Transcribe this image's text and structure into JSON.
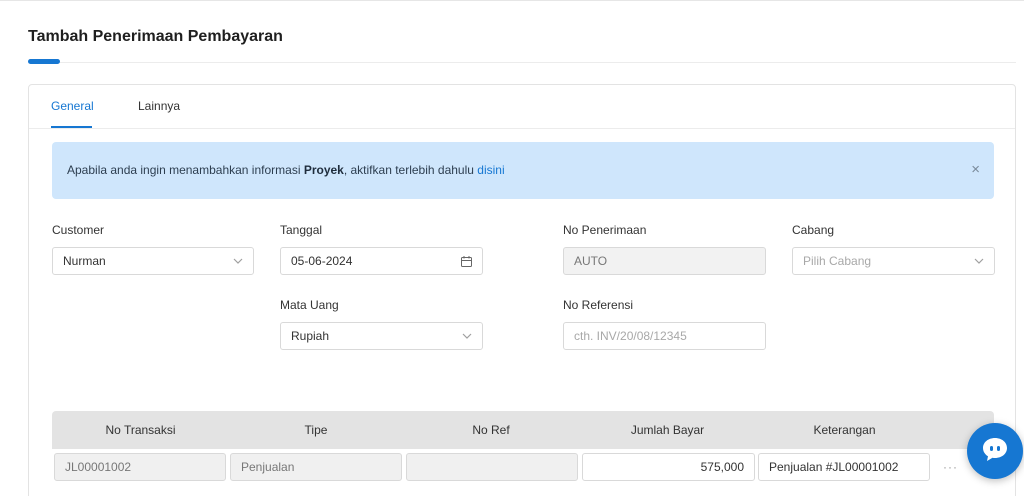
{
  "page": {
    "title": "Tambah Penerimaan Pembayaran"
  },
  "tabs": [
    {
      "label": "General",
      "active": true
    },
    {
      "label": "Lainnya",
      "active": false
    }
  ],
  "alert": {
    "text_before": "Apabila anda ingin menambahkan informasi ",
    "bold": "Proyek",
    "text_after": ", aktifkan terlebih dahulu ",
    "link": "disini",
    "close": "×"
  },
  "form": {
    "customer": {
      "label": "Customer",
      "value": "Nurman"
    },
    "tanggal": {
      "label": "Tanggal",
      "value": "05-06-2024"
    },
    "no_penerimaan": {
      "label": "No Penerimaan",
      "value": "AUTO"
    },
    "cabang": {
      "label": "Cabang",
      "placeholder": "Pilih Cabang"
    },
    "mata_uang": {
      "label": "Mata Uang",
      "value": "Rupiah"
    },
    "no_referensi": {
      "label": "No Referensi",
      "placeholder": "cth. INV/20/08/12345"
    }
  },
  "table": {
    "columns": [
      "No Transaksi",
      "Tipe",
      "No Ref",
      "Jumlah Bayar",
      "Keterangan"
    ],
    "rows": [
      {
        "no_transaksi": "JL00001002",
        "tipe": "Penjualan",
        "no_ref": "",
        "jumlah_bayar": "575,000",
        "keterangan": "Penjualan #JL00001002"
      }
    ],
    "row_menu": "···"
  },
  "colors": {
    "accent": "#1677d2",
    "alert_bg": "#cfe6fc",
    "table_header_bg": "#e3e3e3"
  },
  "icons": {
    "calendar": "calendar-icon",
    "chevron": "chevron-down-icon",
    "close": "close-icon",
    "chat": "chat-bubble-icon"
  }
}
